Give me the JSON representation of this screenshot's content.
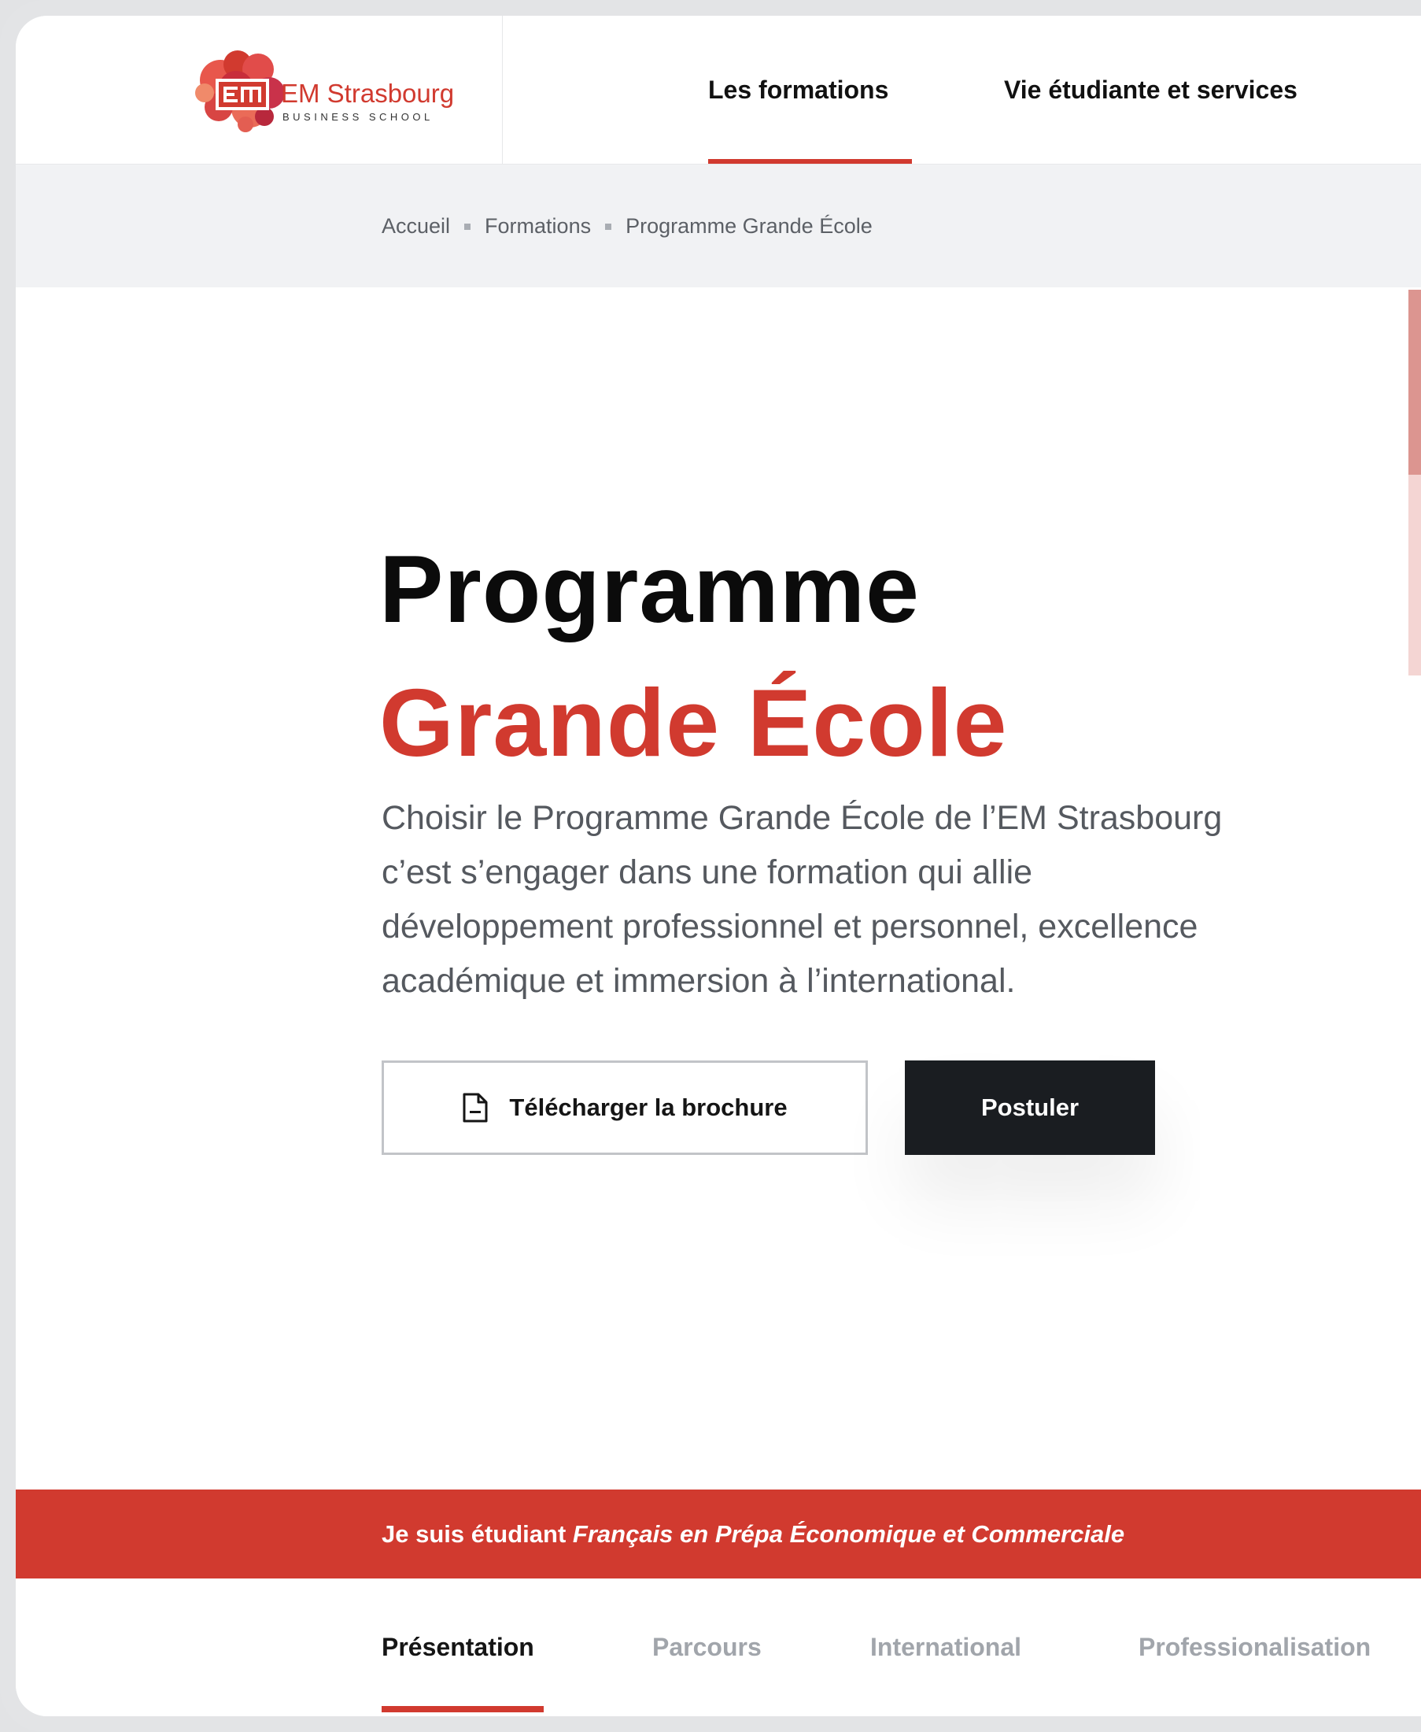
{
  "header": {
    "logo": {
      "brand": "EM Strasbourg",
      "tagline": "BUSINESS SCHOOL"
    },
    "nav": [
      {
        "label": "Les formations",
        "active": true
      },
      {
        "label": "Vie étudiante et services",
        "active": false
      }
    ]
  },
  "breadcrumb": [
    "Accueil",
    "Formations",
    "Programme Grande École"
  ],
  "hero": {
    "title_line1": "Programme",
    "title_line2": "Grande École",
    "description_lines": [
      "Choisir le Programme Grande École de l’EM Strasbourg",
      "c’est s’engager dans une formation qui allie",
      "développement professionnel et personnel, excellence",
      "académique et immersion à l’international."
    ],
    "brochure_button": "Télécharger la brochure",
    "apply_button": "Postuler"
  },
  "banner": {
    "prefix": "Je suis étudiant ",
    "emphasis": "Français en Prépa Économique et Commerciale"
  },
  "tabs": [
    {
      "label": "Présentation",
      "active": true
    },
    {
      "label": "Parcours",
      "active": false
    },
    {
      "label": "International",
      "active": false
    },
    {
      "label": "Professionalisation",
      "active": false
    }
  ],
  "colors": {
    "accent": "#d13a2f",
    "dark_button": "#1a1d21",
    "breadcrumb_bg": "#f1f2f4"
  },
  "icons": {
    "brochure": "document-icon",
    "breadcrumb_separator": "square-bullet"
  }
}
